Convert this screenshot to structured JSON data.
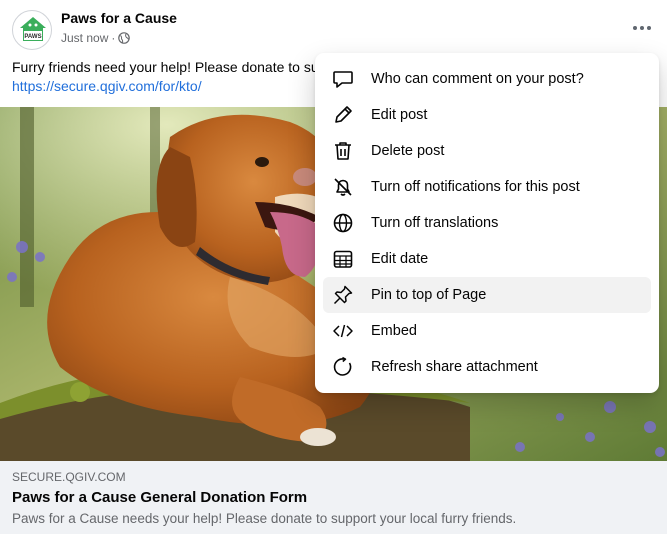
{
  "post": {
    "author": "Paws for a Cause",
    "timestamp": "Just now",
    "separator": "·",
    "privacy_icon": "globe-icon",
    "text": "Furry friends need your help! Please donate to su",
    "link": "https://secure.qgiv.com/for/kto/"
  },
  "avatar": {
    "logo_text": "PAWS",
    "accent": "#3aae5b"
  },
  "link_card": {
    "domain": "SECURE.QGIV.COM",
    "title": "Paws for a Cause General Donation Form",
    "description": "Paws for a Cause needs your help! Please donate to support your local furry friends."
  },
  "menu": {
    "items": [
      {
        "label": "Who can comment on your post?",
        "icon": "speech-bubble-icon"
      },
      {
        "label": "Edit post",
        "icon": "pencil-icon"
      },
      {
        "label": "Delete post",
        "icon": "trash-icon"
      },
      {
        "label": "Turn off notifications for this post",
        "icon": "bell-off-icon"
      },
      {
        "label": "Turn off translations",
        "icon": "globe-icon"
      },
      {
        "label": "Edit date",
        "icon": "calendar-icon"
      },
      {
        "label": "Pin to top of Page",
        "icon": "pin-icon"
      },
      {
        "label": "Embed",
        "icon": "code-icon"
      },
      {
        "label": "Refresh share attachment",
        "icon": "refresh-icon"
      }
    ]
  },
  "colors": {
    "link": "#216fdb",
    "card_bg": "#f0f2f5",
    "secondary_text": "#65676b"
  }
}
